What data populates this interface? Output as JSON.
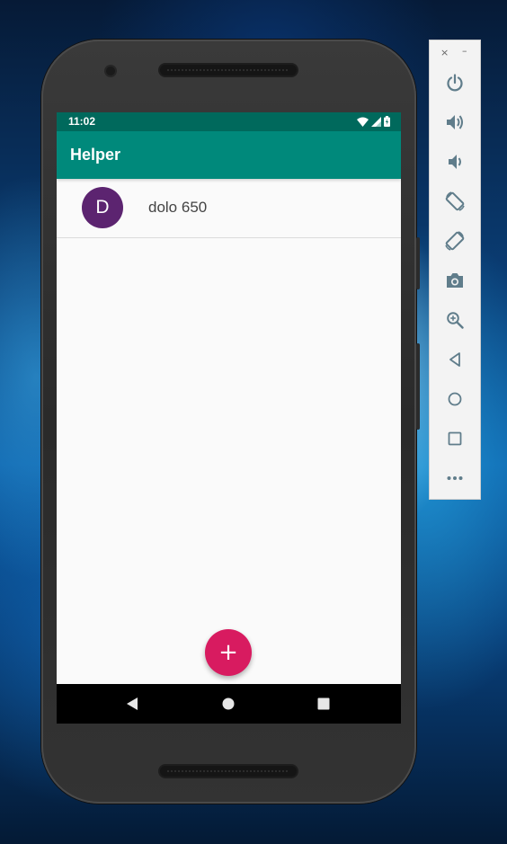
{
  "status_bar": {
    "time": "11:02"
  },
  "app_bar": {
    "title": "Helper"
  },
  "list": {
    "items": [
      {
        "avatar_letter": "D",
        "text": "dolo 650"
      }
    ]
  },
  "fab": {
    "label": "+",
    "icon": "add-icon"
  },
  "nav_bar": {
    "buttons": [
      "back-icon",
      "home-icon",
      "recents-icon"
    ]
  },
  "emulator_toolbar": {
    "close_label": "×",
    "minimize_label": "–",
    "buttons": [
      "power-icon",
      "volume-up-icon",
      "volume-down-icon",
      "rotate-left-icon",
      "rotate-right-icon",
      "camera-icon",
      "zoom-icon",
      "back-icon",
      "home-icon",
      "overview-icon",
      "more-icon"
    ]
  },
  "colors": {
    "status_bar": "#00695c",
    "app_bar": "#00897b",
    "fab": "#d81b60",
    "avatar": "#5c2470",
    "toolbar_icon": "#607d8b"
  }
}
